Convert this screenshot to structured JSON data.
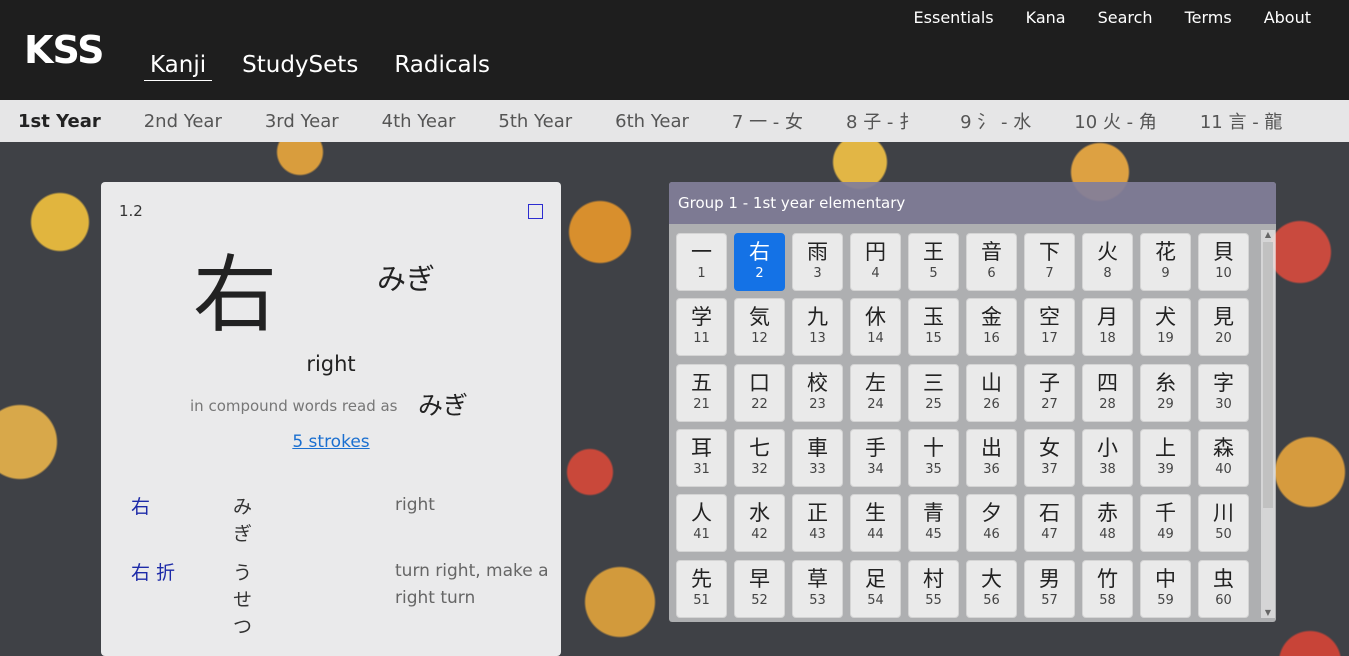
{
  "header": {
    "logo": "KSS",
    "top_links": [
      "Essentials",
      "Kana",
      "Search",
      "Terms",
      "About"
    ],
    "main_tabs": [
      "Kanji",
      "StudySets",
      "Radicals"
    ],
    "active_tab": "Kanji"
  },
  "years": [
    "1st Year",
    "2nd Year",
    "3rd Year",
    "4th Year",
    "5th Year",
    "6th Year",
    "7 一 - 女",
    "8 子 - 扌",
    "9 氵 - 水",
    "10 火 - 角",
    "11 言 - 龍"
  ],
  "active_year": "1st Year",
  "card": {
    "index": "1.2",
    "kanji": "右",
    "kun_reading": "みぎ",
    "meaning": "right",
    "compound_label": "in compound words read as",
    "compound_reading": "みぎ",
    "strokes": "5 strokes",
    "vocab": [
      {
        "word": "右",
        "reading": "みぎ",
        "gloss": "right"
      },
      {
        "word": "右 折",
        "reading": "うせつ",
        "gloss": "turn right, make a right turn"
      }
    ]
  },
  "panel": {
    "title": "Group 1 - 1st year elementary",
    "active_index": 2,
    "kanji": [
      {
        "k": "一",
        "n": "1"
      },
      {
        "k": "右",
        "n": "2"
      },
      {
        "k": "雨",
        "n": "3"
      },
      {
        "k": "円",
        "n": "4"
      },
      {
        "k": "王",
        "n": "5"
      },
      {
        "k": "音",
        "n": "6"
      },
      {
        "k": "下",
        "n": "7"
      },
      {
        "k": "火",
        "n": "8"
      },
      {
        "k": "花",
        "n": "9"
      },
      {
        "k": "貝",
        "n": "10"
      },
      {
        "k": "学",
        "n": "11"
      },
      {
        "k": "気",
        "n": "12"
      },
      {
        "k": "九",
        "n": "13"
      },
      {
        "k": "休",
        "n": "14"
      },
      {
        "k": "玉",
        "n": "15"
      },
      {
        "k": "金",
        "n": "16"
      },
      {
        "k": "空",
        "n": "17"
      },
      {
        "k": "月",
        "n": "18"
      },
      {
        "k": "犬",
        "n": "19"
      },
      {
        "k": "見",
        "n": "20"
      },
      {
        "k": "五",
        "n": "21"
      },
      {
        "k": "口",
        "n": "22"
      },
      {
        "k": "校",
        "n": "23"
      },
      {
        "k": "左",
        "n": "24"
      },
      {
        "k": "三",
        "n": "25"
      },
      {
        "k": "山",
        "n": "26"
      },
      {
        "k": "子",
        "n": "27"
      },
      {
        "k": "四",
        "n": "28"
      },
      {
        "k": "糸",
        "n": "29"
      },
      {
        "k": "字",
        "n": "30"
      },
      {
        "k": "耳",
        "n": "31"
      },
      {
        "k": "七",
        "n": "32"
      },
      {
        "k": "車",
        "n": "33"
      },
      {
        "k": "手",
        "n": "34"
      },
      {
        "k": "十",
        "n": "35"
      },
      {
        "k": "出",
        "n": "36"
      },
      {
        "k": "女",
        "n": "37"
      },
      {
        "k": "小",
        "n": "38"
      },
      {
        "k": "上",
        "n": "39"
      },
      {
        "k": "森",
        "n": "40"
      },
      {
        "k": "人",
        "n": "41"
      },
      {
        "k": "水",
        "n": "42"
      },
      {
        "k": "正",
        "n": "43"
      },
      {
        "k": "生",
        "n": "44"
      },
      {
        "k": "青",
        "n": "45"
      },
      {
        "k": "夕",
        "n": "46"
      },
      {
        "k": "石",
        "n": "47"
      },
      {
        "k": "赤",
        "n": "48"
      },
      {
        "k": "千",
        "n": "49"
      },
      {
        "k": "川",
        "n": "50"
      },
      {
        "k": "先",
        "n": "51"
      },
      {
        "k": "早",
        "n": "52"
      },
      {
        "k": "草",
        "n": "53"
      },
      {
        "k": "足",
        "n": "54"
      },
      {
        "k": "村",
        "n": "55"
      },
      {
        "k": "大",
        "n": "56"
      },
      {
        "k": "男",
        "n": "57"
      },
      {
        "k": "竹",
        "n": "58"
      },
      {
        "k": "中",
        "n": "59"
      },
      {
        "k": "虫",
        "n": "60"
      }
    ]
  }
}
